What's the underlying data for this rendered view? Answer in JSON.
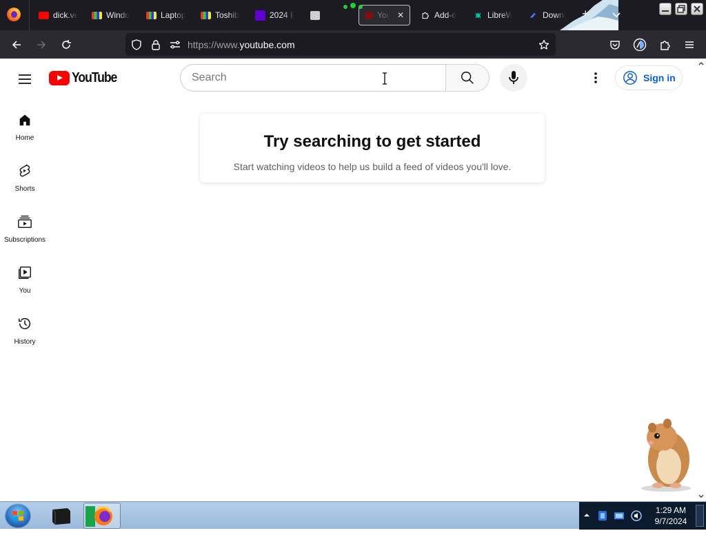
{
  "browser": {
    "tabs": [
      {
        "title": "dick.ve",
        "favicon_color": "#ff0000"
      },
      {
        "title": "Windo",
        "favicon_color": "#7b4fc9"
      },
      {
        "title": "Laptop",
        "favicon_color": "#7b4fc9"
      },
      {
        "title": "Toshib",
        "favicon_color": "#7b4fc9"
      },
      {
        "title": "2024 E",
        "favicon_color": "#6001d2"
      },
      {
        "title": "",
        "favicon_color": "#dddddd"
      },
      {
        "title": "You",
        "favicon_color": "#ff0000",
        "active": true
      },
      {
        "title": "Add-o",
        "favicon_color": "#ffffff"
      },
      {
        "title": "LibreW",
        "favicon_color": "#00c2a8"
      },
      {
        "title": "Downl",
        "favicon_color": "#3a6df0"
      }
    ],
    "url_prefix": "https://www.",
    "url_domain": "youtube.com"
  },
  "youtube": {
    "logo_text": "YouTube",
    "search_placeholder": "Search",
    "sign_in_label": "Sign in",
    "guide": [
      {
        "label": "Home",
        "icon": "home-icon"
      },
      {
        "label": "Shorts",
        "icon": "shorts-icon"
      },
      {
        "label": "Subscriptions",
        "icon": "subscriptions-icon"
      },
      {
        "label": "You",
        "icon": "you-icon"
      },
      {
        "label": "History",
        "icon": "history-icon"
      }
    ],
    "empty_state": {
      "title": "Try searching to get started",
      "message": "Start watching videos to help us build a feed of videos you'll love."
    }
  },
  "taskbar": {
    "time": "1:29 AM",
    "date": "9/7/2024"
  },
  "colors": {
    "youtube_red": "#ff0000",
    "sign_in_blue": "#065fd4",
    "browser_chrome": "#2b2a33"
  }
}
